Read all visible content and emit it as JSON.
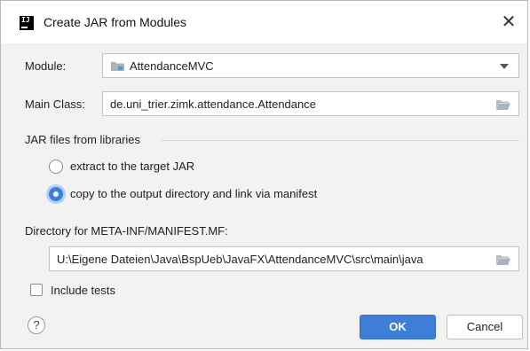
{
  "window": {
    "title": "Create JAR from Modules",
    "app_icon_text": "IJ",
    "close_glyph": "✕"
  },
  "module": {
    "label": "Module:",
    "value": "AttendanceMVC",
    "icon": "module-folder-icon"
  },
  "main_class": {
    "label": "Main Class:",
    "value": "de.uni_trier.zimk.attendance.Attendance",
    "icon": "folder-browse-icon"
  },
  "jar_libraries": {
    "section_title": "JAR files from libraries",
    "options": [
      {
        "label": "extract to the target JAR",
        "selected": false
      },
      {
        "label": "copy to the output directory and link via manifest",
        "selected": true
      }
    ]
  },
  "manifest": {
    "label": "Directory for META-INF/MANIFEST.MF:",
    "value": "U:\\Eigene Dateien\\Java\\BspUeb\\JavaFX\\AttendanceMVC\\src\\main\\java",
    "icon": "folder-browse-icon"
  },
  "include_tests": {
    "label": "Include tests",
    "checked": false
  },
  "buttons": {
    "help": "?",
    "ok": "OK",
    "cancel": "Cancel"
  },
  "colors": {
    "accent": "#3d7ed9",
    "background": "#f2f2f2",
    "folder_icon": "#a9b4bf"
  }
}
